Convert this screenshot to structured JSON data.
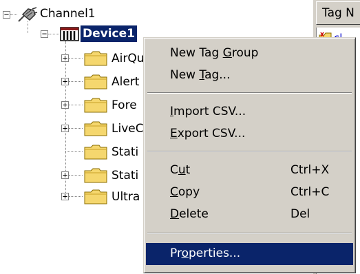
{
  "tree": {
    "channel": {
      "label": "Channel1",
      "expander": "−"
    },
    "device": {
      "label": "Device1",
      "expander": "−"
    },
    "children": [
      {
        "label": "AirQu",
        "expander": "+"
      },
      {
        "label": "Alert",
        "expander": "+"
      },
      {
        "label": "Fore",
        "expander": "+"
      },
      {
        "label": "LiveC",
        "expander": "+"
      },
      {
        "label": "Stati",
        "expander": ""
      },
      {
        "label": "Stati",
        "expander": "+"
      },
      {
        "label": "Ultra",
        "expander": "+"
      }
    ]
  },
  "right_pane": {
    "column_header": "Tag N",
    "first_row_text": "cl"
  },
  "context_menu": {
    "items": [
      {
        "pre": "New Tag ",
        "acc": "G",
        "post": "roup",
        "shortcut": ""
      },
      {
        "pre": "New ",
        "acc": "T",
        "post": "ag...",
        "shortcut": ""
      },
      {
        "pre": "",
        "acc": "I",
        "post": "mport CSV...",
        "shortcut": ""
      },
      {
        "pre": "",
        "acc": "E",
        "post": "xport CSV...",
        "shortcut": ""
      },
      {
        "pre": "C",
        "acc": "u",
        "post": "t",
        "shortcut": "Ctrl+X"
      },
      {
        "pre": "",
        "acc": "C",
        "post": "opy",
        "shortcut": "Ctrl+C"
      },
      {
        "pre": "",
        "acc": "D",
        "post": "elete",
        "shortcut": "Del"
      },
      {
        "pre": "Pr",
        "acc": "o",
        "post": "perties...",
        "shortcut": ""
      }
    ],
    "highlighted_index": 7
  },
  "colors": {
    "selection": "#0a246a",
    "menu_face": "#d4d0c8",
    "folder": "#f5d76e"
  },
  "icons": {
    "channel": "channel-plug-icon",
    "device": "device-icon",
    "folder": "folder-icon"
  }
}
